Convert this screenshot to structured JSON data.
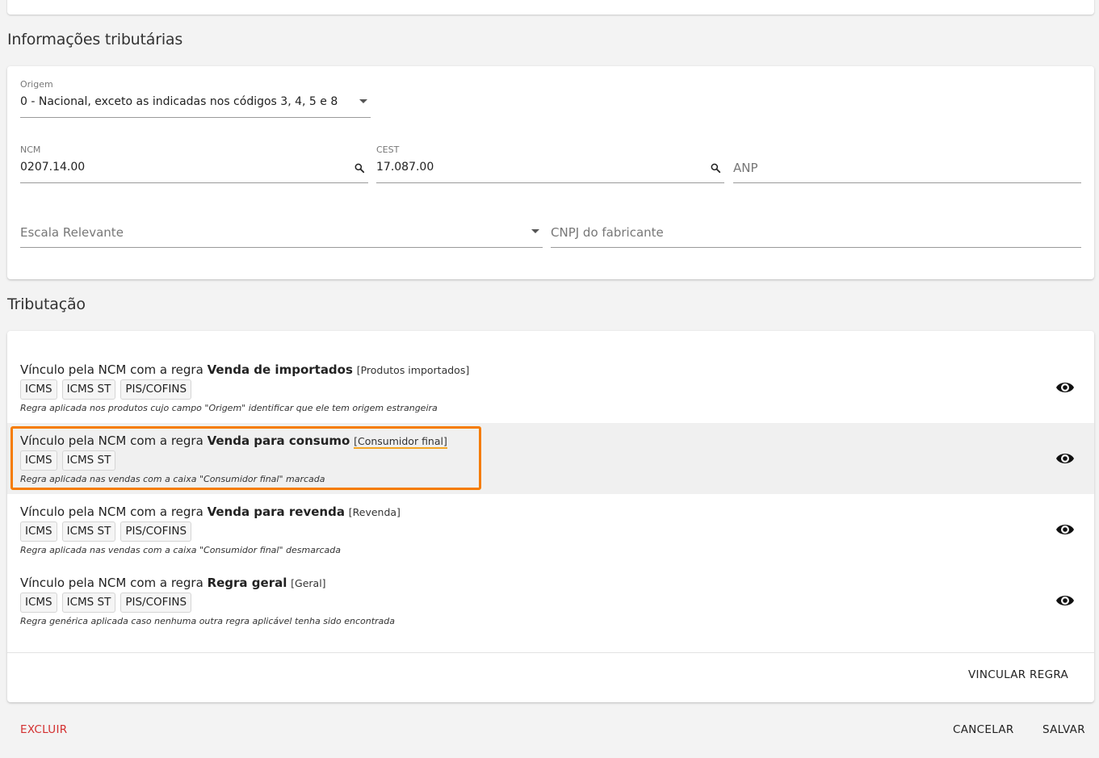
{
  "tax_info": {
    "title": "Informações tributárias",
    "origem": {
      "label": "Origem",
      "value": "0 - Nacional, exceto as indicadas nos códigos 3, 4, 5 e 8"
    },
    "ncm": {
      "label": "NCM",
      "value": "0207.14.00"
    },
    "cest": {
      "label": "CEST",
      "value": "17.087.00"
    },
    "anp": {
      "placeholder": "ANP"
    },
    "escala": {
      "placeholder": "Escala Relevante"
    },
    "cnpj": {
      "placeholder": "CNPJ do fabricante"
    }
  },
  "taxation": {
    "title": "Tributação",
    "rule_prefix": "Vínculo pela NCM com a regra",
    "rules": [
      {
        "name": "Venda de importados",
        "tag": "[Produtos importados]",
        "chips": [
          "ICMS",
          "ICMS ST",
          "PIS/COFINS"
        ],
        "description": "Regra aplicada nos produtos cujo campo \"Origem\" identificar que ele tem origem estrangeira"
      },
      {
        "name": "Venda para consumo",
        "tag": "[Consumidor final]",
        "chips": [
          "ICMS",
          "ICMS ST"
        ],
        "description": "Regra aplicada nas vendas com a caixa \"Consumidor final\" marcada"
      },
      {
        "name": "Venda para revenda",
        "tag": "[Revenda]",
        "chips": [
          "ICMS",
          "ICMS ST",
          "PIS/COFINS"
        ],
        "description": "Regra aplicada nas vendas com a caixa \"Consumidor final\" desmarcada"
      },
      {
        "name": "Regra geral",
        "tag": "[Geral]",
        "chips": [
          "ICMS",
          "ICMS ST",
          "PIS/COFINS"
        ],
        "description": "Regra genérica aplicada caso nenhuma outra regra aplicável tenha sido encontrada"
      }
    ],
    "link_button": "VINCULAR REGRA"
  },
  "footer": {
    "delete": "EXCLUIR",
    "cancel": "CANCELAR",
    "save": "SALVAR"
  },
  "colors": {
    "highlight": "#f57c00",
    "danger": "#d32f2f"
  },
  "icons": {
    "search": "search-icon",
    "view": "eye-icon",
    "dropdown": "caret-down-icon"
  }
}
